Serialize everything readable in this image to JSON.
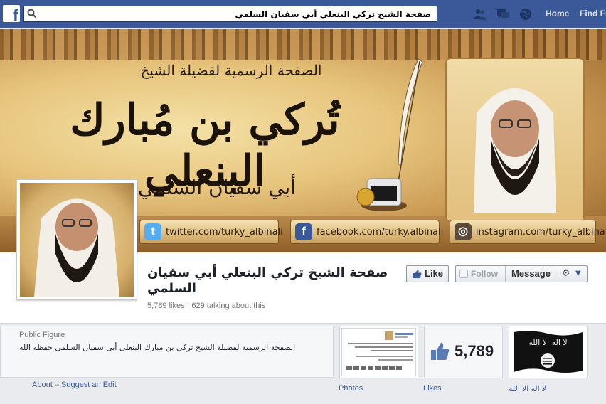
{
  "topbar": {
    "logo": "f",
    "search_value": "صفحة الشيخ تركي البنعلي أبي سفيان السلمي",
    "nav": {
      "home": "Home",
      "find_friends": "Find Fr"
    },
    "icons": [
      "friend-requests-icon",
      "messages-icon",
      "notifications-globe-icon"
    ],
    "brand_color": "#3b5998"
  },
  "cover": {
    "title_line": "الصفحة الرسمية لفضيلة الشيخ",
    "big_name": "تُركي بن مُبارك البنعلي",
    "kunya": "أبي سفيان السُلمي",
    "social": {
      "twitter": "twitter.com/turky_albinali",
      "facebook": "facebook.com/turky.albinali",
      "instagram": "instagram.com/turky_albinali"
    }
  },
  "page": {
    "name": "صفحة الشيخ تركي البنعلي أبي سفيان السلمي",
    "stats": "5,789 likes · 629 talking about this",
    "buttons": {
      "like": "Like",
      "follow": "Follow",
      "message": "Message",
      "gear": "⚙"
    }
  },
  "about": {
    "category": "Public Figure",
    "description": "الصفحة الرسمية لفضيلة الشيخ تركى بن مبارك البنعلى أبى سفيان السلمى حفظه الله",
    "about_link": "About",
    "separator": "–",
    "suggest_link": "Suggest an Edit"
  },
  "thumbs": {
    "photos_label": "Photos",
    "likes_label": "Likes",
    "likes_count": "5,789",
    "flag_label": "لا اله الا الله",
    "flag_text": "لا اله الا الله"
  }
}
